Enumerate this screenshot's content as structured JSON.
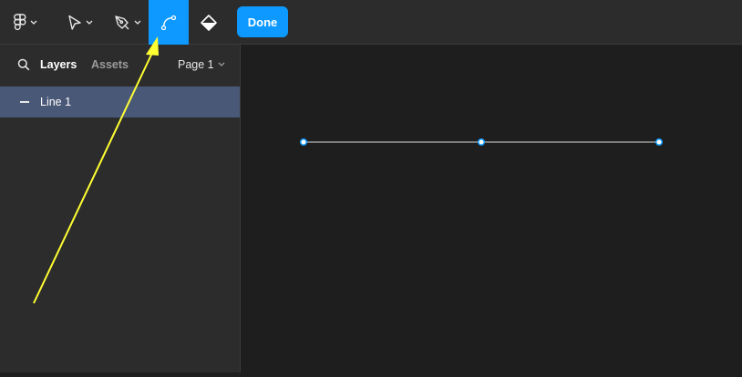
{
  "toolbar": {
    "tools": [
      {
        "icon": "figma-menu-icon",
        "has_dropdown": true
      },
      {
        "icon": "move-tool-icon",
        "has_dropdown": true
      },
      {
        "icon": "pen-tool-icon",
        "has_dropdown": true
      },
      {
        "icon": "bend-tool-icon",
        "active": true
      },
      {
        "icon": "paint-bucket-icon"
      }
    ],
    "done_label": "Done"
  },
  "sidebar": {
    "tabs": {
      "layers": "Layers",
      "assets": "Assets"
    },
    "page_selector": "Page 1",
    "layers": [
      {
        "label": "Line 1",
        "selected": true
      }
    ]
  },
  "canvas": {
    "shape": "line",
    "vertex_count": 3
  },
  "annotation": {
    "type": "arrow",
    "color": "#ffff33",
    "points_to": "bend-tool"
  },
  "colors": {
    "toolbar_bg": "#2c2c2c",
    "canvas_bg": "#1e1e1e",
    "accent": "#0d99ff",
    "selected_layer": "#4a5878"
  }
}
